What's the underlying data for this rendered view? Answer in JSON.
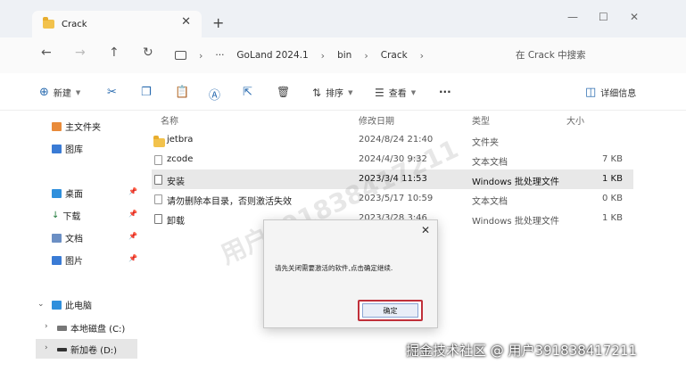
{
  "tab": {
    "title": "Crack"
  },
  "navigation": {
    "breadcrumb": [
      "GoLand 2024.1",
      "bin",
      "Crack"
    ],
    "more": "···",
    "search_placeholder": "在 Crack 中搜索"
  },
  "toolbar": {
    "new_label": "新建",
    "sort_label": "排序",
    "view_label": "查看",
    "more": "···",
    "details_label": "详细信息"
  },
  "sidebar": {
    "quick": [
      {
        "label": "主文件夹",
        "icon": "home-icon"
      },
      {
        "label": "图库",
        "icon": "gallery-icon"
      }
    ],
    "pinned": [
      {
        "label": "桌面",
        "icon": "desktop-icon"
      },
      {
        "label": "下载",
        "icon": "download-icon"
      },
      {
        "label": "文档",
        "icon": "document-icon"
      },
      {
        "label": "图片",
        "icon": "pictures-icon"
      }
    ],
    "this_pc": {
      "label": "此电脑",
      "icon": "pc-icon"
    },
    "drives": [
      {
        "label": "本地磁盘 (C:)",
        "icon": "drive-icon"
      },
      {
        "label": "新加卷 (D:)",
        "icon": "drive-icon"
      }
    ]
  },
  "columns": {
    "name": "名称",
    "date": "修改日期",
    "type": "类型",
    "size": "大小"
  },
  "files": [
    {
      "name": "jetbra",
      "date": "2024/8/24 21:40",
      "type": "文件夹",
      "size": "",
      "icon": "folder-icon"
    },
    {
      "name": "zcode",
      "date": "2024/4/30 9:32",
      "type": "文本文档",
      "size": "7 KB",
      "icon": "text-file-icon"
    },
    {
      "name": "安装",
      "date": "2023/3/4 11:53",
      "type": "Windows 批处理文件",
      "size": "1 KB",
      "icon": "batch-file-icon"
    },
    {
      "name": "请勿删除本目录，否则激活失效",
      "date": "2023/5/17 10:59",
      "type": "文本文档",
      "size": "0 KB",
      "icon": "text-file-icon"
    },
    {
      "name": "卸载",
      "date": "2023/3/28 3:46",
      "type": "Windows 批处理文件",
      "size": "1 KB",
      "icon": "batch-file-icon"
    }
  ],
  "selected_row_index": 2,
  "watermark": "用户391838417211",
  "dialog": {
    "message": "请先关闭需要激活的软件,点击确定继续.",
    "ok_label": "确定"
  },
  "credit": "掘金技术社区 @ 用户391838417211",
  "colors": {
    "accent": "#2b6cb0",
    "folder": "#f2c24c",
    "highlight": "#c0303a"
  }
}
